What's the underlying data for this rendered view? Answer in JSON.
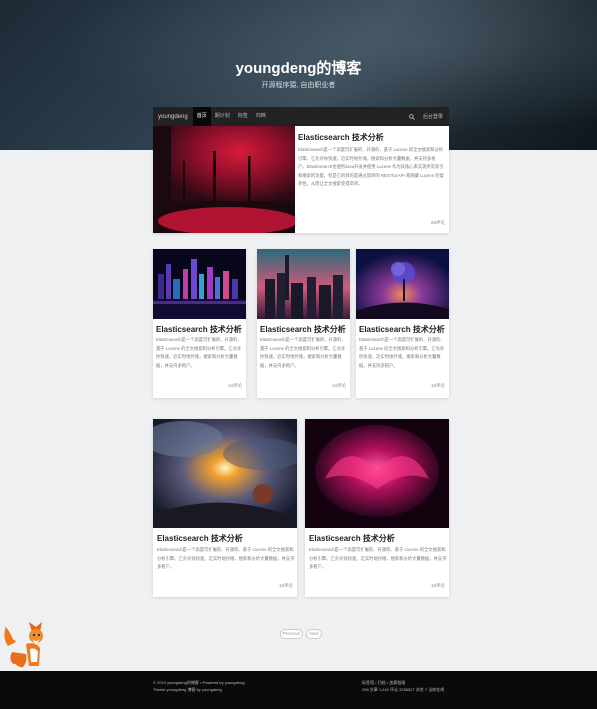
{
  "site": {
    "title": "youngdeng的博客",
    "subtitle": "开源程序猿, 自由职业者"
  },
  "nav": {
    "brand": "youngdeng",
    "items": [
      "首页",
      "期计划",
      "标签",
      "归档"
    ],
    "active_index": 0,
    "signin": "后台登录"
  },
  "featured": {
    "title": "Elasticsearch 技术分析",
    "excerpt": "Elasticsearch是一个高度可扩展的、开源的、基于 Lucene 的全文搜索和分析引擎。它允许你快速，近实时地存储，搜索和分析大量数据，并支持多租户。Elasticsearch也使用Java开发并使用 Lucene 作为其核心来实现所有索引和搜索的功能，但是它的目的是通过简单的 RESTful API 来隐藏 Lucene 的复杂性，从而让全文搜索变得简单。",
    "comments": "66评论"
  },
  "cards_row1": [
    {
      "title": "Elasticsearch 技术分析",
      "excerpt": "Elasticsearch是一个高度可扩展的、开源的、基于 Lucene 的全文搜索和分析引擎。它允许你快速，近实时地存储，搜索和分析大量数据，并支持多租户。",
      "comments": "10评论"
    },
    {
      "title": "Elasticsearch 技术分析",
      "excerpt": "Elasticsearch是一个高度可扩展的、开源的、基于 Lucene 的全文搜索和分析引擎。它允许你快速，近实时地存储，搜索和分析大量数据，并支持多租户。",
      "comments": "10评论"
    },
    {
      "title": "Elasticsearch 技术分析",
      "excerpt": "Elasticsearch是一个高度可扩展的、开源的、基于 Lucene 的全文搜索和分析引擎。它允许你快速，近实时地存储，搜索和分析大量数据，并支持多租户。",
      "comments": "10评论"
    }
  ],
  "cards_row2": [
    {
      "title": "Elasticsearch 技术分析",
      "excerpt": "Elasticsearch是一个高度可扩展的、开源的、基于 Lucene 的全文搜索和分析引擎。它允许你快速，近实时地存储，搜索和分析大量数据，并支持多租户。",
      "comments": "10评论"
    },
    {
      "title": "Elasticsearch 技术分析",
      "excerpt": "Elasticsearch是一个高度可扩展的、开源的、基于 Lucene 的全文搜索和分析引擎。它允许你快速，近实时地存储，搜索和分析大量数据，并支持多租户。",
      "comments": "10评论"
    }
  ],
  "pagination": {
    "prev": "Previous",
    "next": "Next"
  },
  "footer": {
    "copyright": "© 2019 youngdeng的博客 • Powered by youngdeng",
    "theme": "Theme youngdeng 博客 by youngdeng",
    "links": "标签墙 • 归档 • 加载链接",
    "stats": "396 文章 1,642 评论 3256527 浏览 7 当前在线"
  },
  "colors": {
    "navbar": "#222222",
    "footer": "#0a0a0a",
    "page_bg": "#eef0f2"
  }
}
